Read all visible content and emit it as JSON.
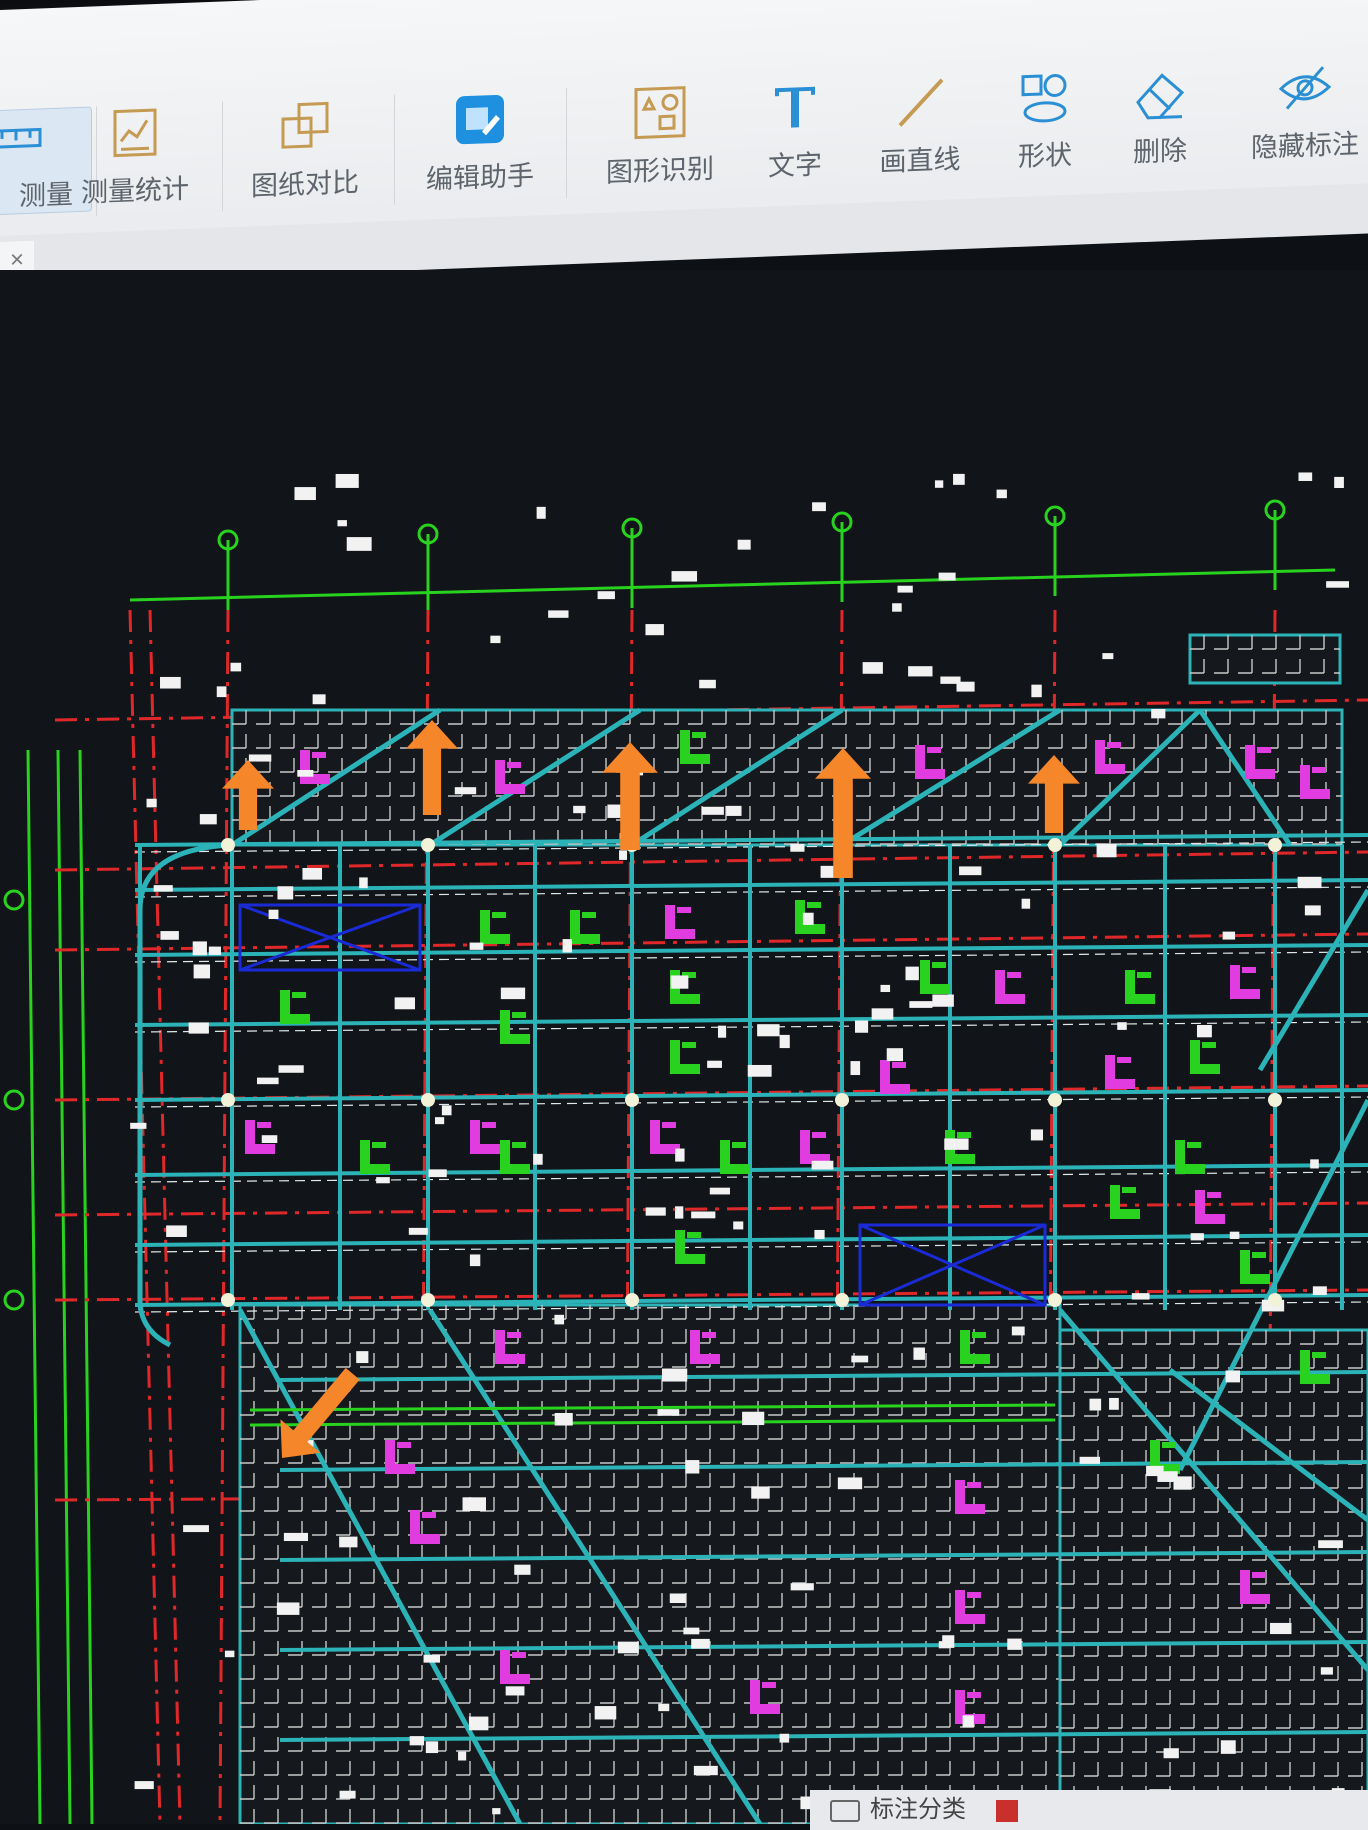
{
  "toolbar": {
    "items": [
      {
        "label": "测量",
        "icon": "ruler-icon"
      },
      {
        "label": "测量统计",
        "icon": "measure-stats-icon"
      },
      {
        "label": "图纸对比",
        "icon": "compare-drawings-icon"
      },
      {
        "label": "编辑助手",
        "icon": "edit-assistant-icon"
      },
      {
        "label": "图形识别",
        "icon": "shape-recognition-icon"
      },
      {
        "label": "文字",
        "icon": "text-icon"
      },
      {
        "label": "画直线",
        "icon": "draw-line-icon"
      },
      {
        "label": "形状",
        "icon": "shape-icon"
      },
      {
        "label": "删除",
        "icon": "eraser-icon"
      },
      {
        "label": "隐藏标注",
        "icon": "hide-annotation-icon"
      }
    ]
  },
  "tab": {
    "close_glyph": "×"
  },
  "status": {
    "label": "标注分类"
  },
  "colors": {
    "background": "#111418",
    "grid_green": "#28d21e",
    "axis_red": "#e0282a",
    "beam_cyan": "#2bb3b8",
    "magenta": "#e03ce0",
    "arrow_orange": "#f5862a",
    "hatch_blue": "#1a2bd6"
  },
  "annotations": {
    "arrows": [
      "up",
      "up",
      "up",
      "up",
      "up",
      "down-left"
    ]
  }
}
